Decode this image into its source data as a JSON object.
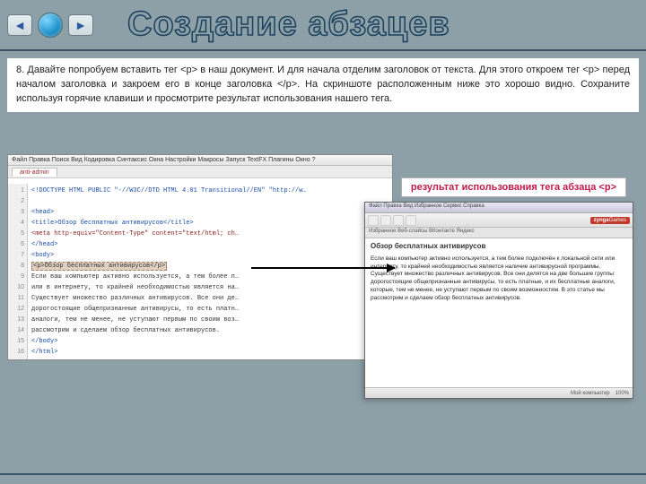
{
  "header": {
    "title": "Создание абзацев"
  },
  "instruction": {
    "step_number": "8.",
    "text": "Давайте попробуем вставить тег <p> в наш документ. И для начала отделим заголовок от текста. Для этого откроем тег <p> перед началом заголовка и закроем его в конце заголовка </p>. На скриншоте расположенным ниже это хорошо видно. Сохраните используя горячие клавиши и просмотрите результат использования нашего тега."
  },
  "result_label": "результат использования тега абзаца <p>",
  "editor": {
    "menu": "Файл  Правка  Поиск  Вид  Кодировка  Синтаксис  Окна  Настройки  Макросы  Запуск  TextFX  Плагины  Окно  ?",
    "tab": "anti-admin",
    "lines": [
      "<!DOCTYPE HTML PUBLIC \"-//W3C//DTD HTML 4.01 Transitional//EN\" \"http://w…",
      "",
      "<head>",
      "<title>Обзор бесплатных антивирусов</title>",
      "<meta http-equiv=\"Content-Type\" content=\"text/html; ch…",
      "</head>",
      "<body>",
      "<p>Обзор бесплатных антивирусов</p>",
      "Если ваш компьютер активно используется, а тем более п…",
      "или в интернету, то крайней необходимостью является на…",
      "Существует множество различных антивирусов. Все они де…",
      "дорогостоящие общепризнанные антивирусы, то есть платн…",
      "аналоги, тем не менее, не уступают первым по своим воз…",
      "рассмотрим и сделаем обзор бесплатных антивирусов.",
      "</body>",
      "</html>"
    ]
  },
  "browser": {
    "titlebar": "Файл  Правка  Вид  Избранное  Сервис  Справка",
    "zynga": "zynga",
    "zynga_suffix": "Games",
    "tabbar_items": "Избранное   Веб-слайсы   ВКонтакте   Яндекс",
    "heading": "Обзор бесплатных антивирусов",
    "body": "Если ваш компьютер активно используется, а тем более подключён к локальной сети или интернету, то крайней необходимостью является наличие антивирусной программы. Существует множество различных антивирусов. Все они делятся на две большие группы: дорогостоящие общепризнанные антивирусы, то есть платные, и их бесплатные аналоги, которые, тем не менее, не уступают первым по своим возможностям. В это статье мы рассмотрим и сделаем обзор бесплатных антивирусов.",
    "status_zoom": "100%",
    "status_mode": "Мой компьютер"
  }
}
